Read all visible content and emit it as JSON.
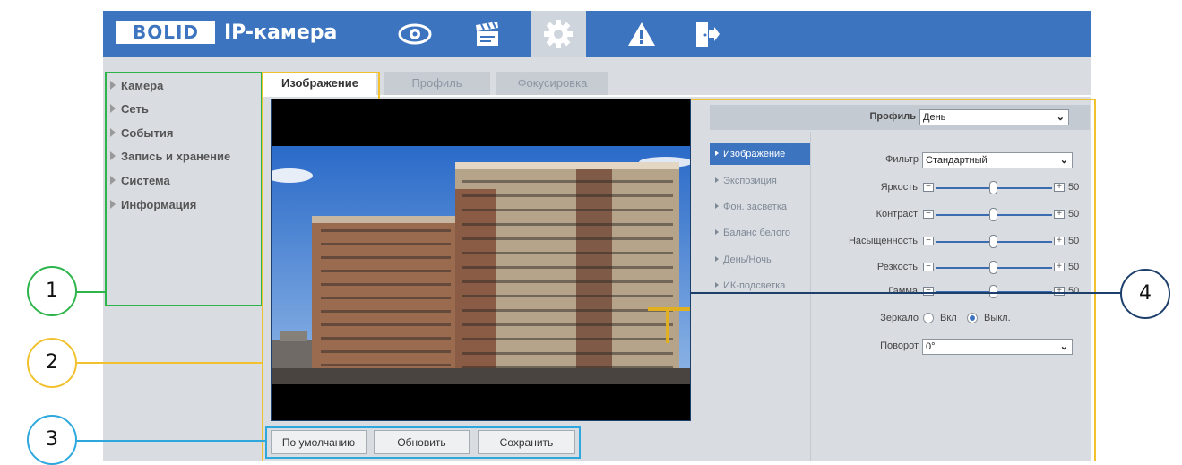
{
  "header": {
    "logo_text": "BOLID",
    "product_title": "IP-камера",
    "nav": [
      {
        "icon": "eye-icon"
      },
      {
        "icon": "clapperboard-icon"
      },
      {
        "icon": "gear-icon",
        "active": true
      },
      {
        "icon": "warning-icon"
      },
      {
        "icon": "logout-icon"
      }
    ]
  },
  "sidebar": {
    "items": [
      "Камера",
      "Сеть",
      "События",
      "Запись и хранение",
      "Система",
      "Информация"
    ]
  },
  "tabs": [
    {
      "label": "Изображение",
      "active": true
    },
    {
      "label": "Профиль"
    },
    {
      "label": "Фокусировка"
    }
  ],
  "buttons": {
    "default": "По умолчанию",
    "refresh": "Обновить",
    "save": "Сохранить"
  },
  "settings": {
    "profile_label": "Профиль",
    "profile_value": "День",
    "menu": [
      "Изображение",
      "Экспозиция",
      "Фон. засветка",
      "Баланс белого",
      "День/Ночь",
      "ИК-подсветка"
    ],
    "filter_label": "Фильтр",
    "filter_value": "Стандартный",
    "sliders": [
      {
        "label": "Яркость",
        "value": "50"
      },
      {
        "label": "Контраст",
        "value": "50"
      },
      {
        "label": "Насыщенность",
        "value": "50"
      },
      {
        "label": "Резкость",
        "value": "50"
      },
      {
        "label": "Гамма",
        "value": "50"
      }
    ],
    "mirror_label": "Зеркало",
    "mirror_on": "Вкл",
    "mirror_off": "Выкл.",
    "mirror_selected": "off",
    "rotate_label": "Поворот",
    "rotate_value": "0°"
  },
  "annotations": {
    "c1": "1",
    "c2": "2",
    "c3": "3",
    "c4": "4",
    "colors": {
      "c1": "#2db54b",
      "c2": "#f2c12e",
      "c3": "#2ea8dc",
      "c4": "#1d3f6b"
    }
  },
  "colors": {
    "brand_blue": "#3d74c0",
    "panel_bg": "#d9dde2"
  }
}
